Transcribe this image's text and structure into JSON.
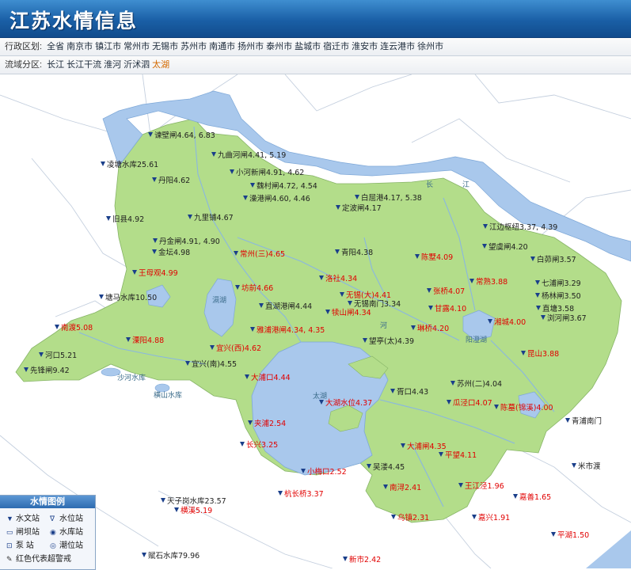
{
  "header": {
    "title": "江苏水情信息"
  },
  "admin": {
    "label": "行政区划:",
    "items": [
      "全省",
      "南京市",
      "镇江市",
      "常州市",
      "无锡市",
      "苏州市",
      "南通市",
      "扬州市",
      "泰州市",
      "盐城市",
      "宿迁市",
      "淮安市",
      "连云港市",
      "徐州市"
    ]
  },
  "basin": {
    "label": "流域分区:",
    "items": [
      "长江",
      "长江干流",
      "淮河",
      "沂沭泗",
      "太湖"
    ],
    "active": "太湖"
  },
  "colors": {
    "land": "#b3dd8a",
    "water": "#a9c8ec",
    "river": "#a9c8ec",
    "alarm": "#e10000",
    "header": "#1a5fa6"
  },
  "stations": [
    {
      "name": "谏壁闸",
      "value": "4.64, 6.83",
      "alarm": false
    },
    {
      "name": "九曲河闸",
      "value": "4.41, 5.19",
      "alarm": false
    },
    {
      "name": "凌塘水库",
      "value": "25.61",
      "alarm": false
    },
    {
      "name": "小河新闸",
      "value": "4.91, 4.62",
      "alarm": false
    },
    {
      "name": "丹阳",
      "value": "4.62",
      "alarm": false
    },
    {
      "name": "魏村闸",
      "value": "4.72, 4.54",
      "alarm": false
    },
    {
      "name": "白屈港",
      "value": "4.17, 5.38",
      "alarm": false
    },
    {
      "name": "澡港闸",
      "value": "4.60, 4.46",
      "alarm": false
    },
    {
      "name": "定波闸",
      "value": "4.17",
      "alarm": false
    },
    {
      "name": "九里铺",
      "value": "4.67",
      "alarm": false
    },
    {
      "name": "旧县",
      "value": "4.92",
      "alarm": false
    },
    {
      "name": "江边枢纽",
      "value": "3.37, 4.39",
      "alarm": false
    },
    {
      "name": "丹金闸",
      "value": "4.91, 4.90",
      "alarm": false
    },
    {
      "name": "金坛",
      "value": "4.98",
      "alarm": false
    },
    {
      "name": "望虞闸",
      "value": "4.20",
      "alarm": false
    },
    {
      "name": "常州(三)",
      "value": "4.65",
      "alarm": true
    },
    {
      "name": "青阳",
      "value": "4.38",
      "alarm": false
    },
    {
      "name": "陈墅",
      "value": "4.09",
      "alarm": true
    },
    {
      "name": "白茆闸",
      "value": "3.57",
      "alarm": false
    },
    {
      "name": "王母观",
      "value": "4.99",
      "alarm": true
    },
    {
      "name": "洛社",
      "value": "4.34",
      "alarm": true
    },
    {
      "name": "常熟",
      "value": "3.88",
      "alarm": true
    },
    {
      "name": "七浦闸",
      "value": "3.29",
      "alarm": false
    },
    {
      "name": "坊前",
      "value": "4.66",
      "alarm": true
    },
    {
      "name": "无锡(大)",
      "value": "4.41",
      "alarm": true
    },
    {
      "name": "张桥",
      "value": "4.07",
      "alarm": true
    },
    {
      "name": "杨林闸",
      "value": "3.50",
      "alarm": false
    },
    {
      "name": "塘马水库",
      "value": "10.50",
      "alarm": false
    },
    {
      "name": "无锡南门",
      "value": "3.34",
      "alarm": false
    },
    {
      "name": "直湖港闸",
      "value": "4.44",
      "alarm": false
    },
    {
      "name": "甘露",
      "value": "4.10",
      "alarm": true
    },
    {
      "name": "直塘",
      "value": "3.58",
      "alarm": false
    },
    {
      "name": "犊山闸",
      "value": "4.34",
      "alarm": true
    },
    {
      "name": "湘城",
      "value": "4.00",
      "alarm": true
    },
    {
      "name": "浏河闸",
      "value": "3.67",
      "alarm": false
    },
    {
      "name": "南渡",
      "value": "5.08",
      "alarm": true
    },
    {
      "name": "琳桥",
      "value": "4.20",
      "alarm": true
    },
    {
      "name": "雅浦港闸",
      "value": "4.34, 4.35",
      "alarm": true
    },
    {
      "name": "溧阳",
      "value": "4.88",
      "alarm": true
    },
    {
      "name": "望亭(太)",
      "value": "4.39",
      "alarm": false
    },
    {
      "name": "河口",
      "value": "5.21",
      "alarm": false
    },
    {
      "name": "宜兴(西)",
      "value": "4.62",
      "alarm": true
    },
    {
      "name": "昆山",
      "value": "3.88",
      "alarm": true
    },
    {
      "name": "宜兴(南)",
      "value": "4.55",
      "alarm": false
    },
    {
      "name": "先锋闸",
      "value": "9.42",
      "alarm": false
    },
    {
      "name": "大浦口",
      "value": "4.44",
      "alarm": true
    },
    {
      "name": "苏州(二)",
      "value": "4.04",
      "alarm": false
    },
    {
      "name": "胥口",
      "value": "4.43",
      "alarm": false
    },
    {
      "name": "大湖水位",
      "value": "4.37",
      "alarm": true
    },
    {
      "name": "瓜泾口",
      "value": "4.07",
      "alarm": true
    },
    {
      "name": "陈墓(锦溪)",
      "value": "4.00",
      "alarm": true
    },
    {
      "name": "青浦南门",
      "value": "",
      "alarm": false
    },
    {
      "name": "夹浦",
      "value": "2.54",
      "alarm": true
    },
    {
      "name": "长兴",
      "value": "3.25",
      "alarm": true
    },
    {
      "name": "大浦闸",
      "value": "4.35",
      "alarm": true
    },
    {
      "name": "平望",
      "value": "4.11",
      "alarm": true
    },
    {
      "name": "米市渡",
      "value": "",
      "alarm": false
    },
    {
      "name": "吴溇",
      "value": "4.45",
      "alarm": false
    },
    {
      "name": "小梅口",
      "value": "2.52",
      "alarm": true
    },
    {
      "name": "天子岗水库",
      "value": "23.57",
      "alarm": false
    },
    {
      "name": "杭长桥",
      "value": "3.37",
      "alarm": true
    },
    {
      "name": "南浔",
      "value": "2.41",
      "alarm": true
    },
    {
      "name": "王江泾",
      "value": "1.96",
      "alarm": true
    },
    {
      "name": "嘉善",
      "value": "1.65",
      "alarm": true
    },
    {
      "name": "横溪",
      "value": "5.19",
      "alarm": true
    },
    {
      "name": "乌镇",
      "value": "2.31",
      "alarm": true
    },
    {
      "name": "嘉兴",
      "value": "1.91",
      "alarm": true
    },
    {
      "name": "平湖",
      "value": "1.50",
      "alarm": true
    },
    {
      "name": "赋石水库",
      "value": "79.96",
      "alarm": false
    },
    {
      "name": "新市",
      "value": "2.42",
      "alarm": true
    }
  ],
  "places": [
    "长",
    "江",
    "河",
    "太湖",
    "滆湖",
    "阳澄湖",
    "沙河水库",
    "横山水库"
  ],
  "legend": {
    "title": "水情图例",
    "items": [
      {
        "icon": "hydrometric-station-icon",
        "symbol": "▼",
        "label": "水文站"
      },
      {
        "icon": "stage-station-icon",
        "symbol": "∇",
        "label": "水位站"
      },
      {
        "icon": "sluice-station-icon",
        "symbol": "▭",
        "label": "闸坝站"
      },
      {
        "icon": "reservoir-station-icon",
        "symbol": "◉",
        "label": "水库站"
      },
      {
        "icon": "pump-station-icon",
        "symbol": "⊡",
        "label": "泵  站"
      },
      {
        "icon": "tide-station-icon",
        "symbol": "◎",
        "label": "潮位站"
      }
    ],
    "note_icon": "pencil-icon",
    "note": "红色代表超警戒"
  }
}
